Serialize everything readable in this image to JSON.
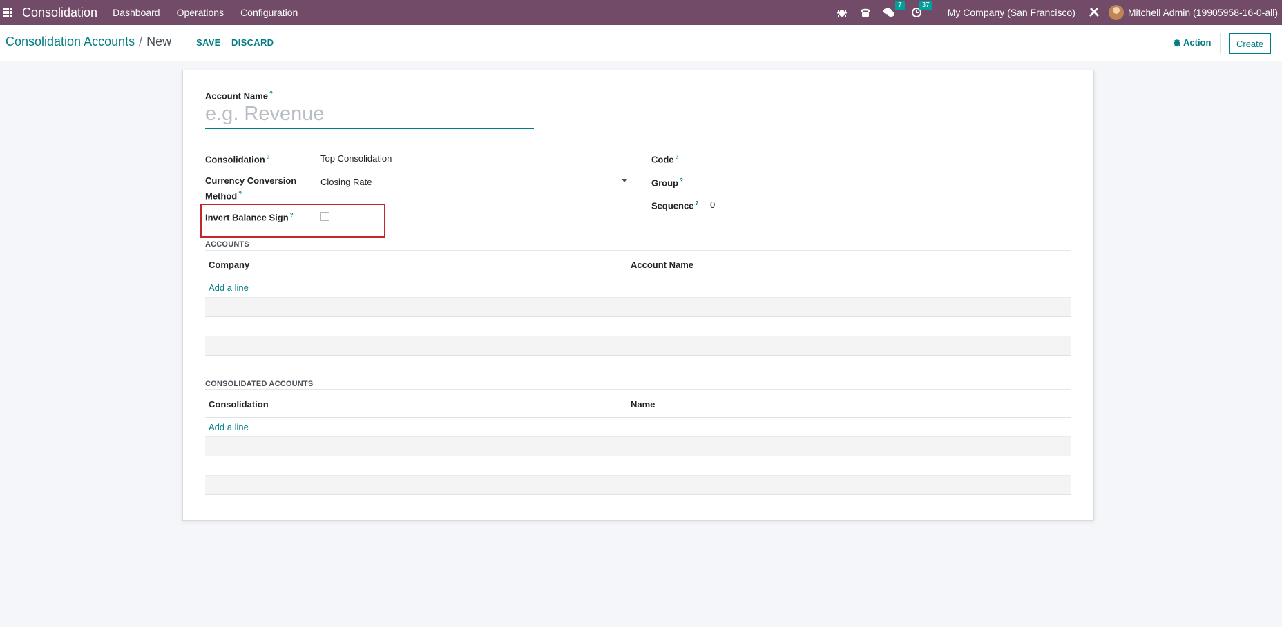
{
  "navbar": {
    "app_name": "Consolidation",
    "menu": [
      "Dashboard",
      "Operations",
      "Configuration"
    ],
    "messages_count": "7",
    "activities_count": "37",
    "company": "My Company (San Francisco)",
    "user": "Mitchell Admin (19905958-16-0-all)"
  },
  "control_panel": {
    "breadcrumb_parent": "Consolidation Accounts",
    "breadcrumb_sep": "/",
    "breadcrumb_current": "New",
    "save_label": "SAVE",
    "discard_label": "DISCARD",
    "action_label": "Action",
    "create_label": "Create"
  },
  "form": {
    "account_name_label": "Account Name",
    "account_name_placeholder": "e.g. Revenue",
    "help_mark": "?",
    "consolidation_label": "Consolidation",
    "consolidation_value": "Top Consolidation",
    "currency_label_line1": "Currency Conversion",
    "currency_label_line2": "Method",
    "currency_value": "Closing Rate",
    "invert_label": "Invert Balance Sign",
    "code_label": "Code",
    "group_label": "Group",
    "sequence_label": "Sequence",
    "sequence_value": "0"
  },
  "accounts_section": {
    "title": "ACCOUNTS",
    "columns": [
      "Company",
      "Account Name"
    ],
    "add_line": "Add a line"
  },
  "consolidated_section": {
    "title": "CONSOLIDATED ACCOUNTS",
    "columns": [
      "Consolidation",
      "Name"
    ],
    "add_line": "Add a line"
  },
  "colors": {
    "navbar": "#714b67",
    "accent": "#017e84",
    "highlight": "#c1272d"
  }
}
